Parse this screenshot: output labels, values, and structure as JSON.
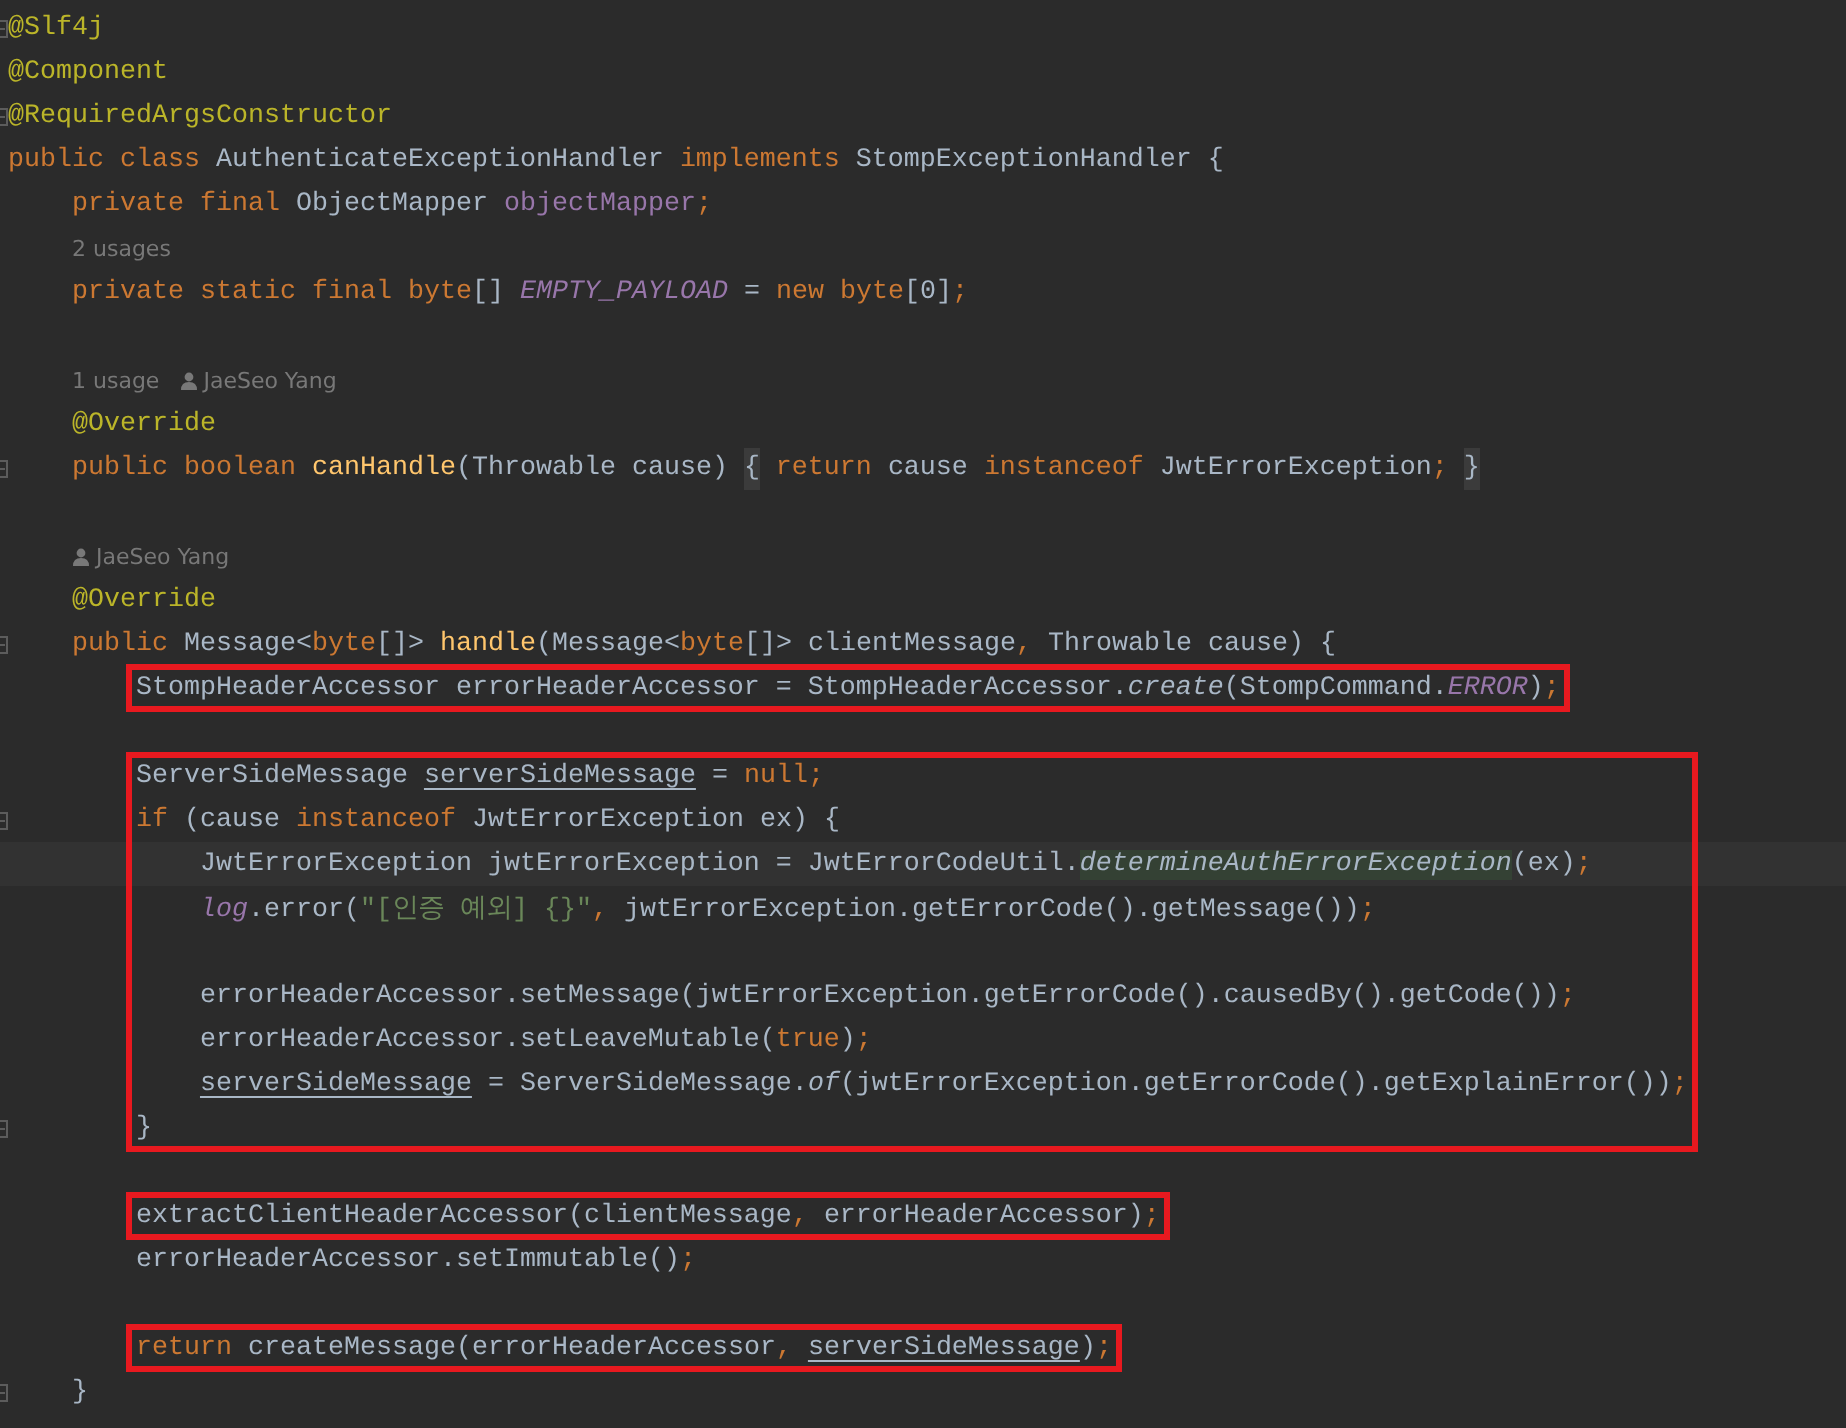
{
  "editor": {
    "blocks": [
      {
        "lines": [
          {
            "kind": "code",
            "fold": true,
            "tokens": [
              {
                "kind": "ann",
                "text": "@Slf4j"
              }
            ]
          },
          {
            "kind": "code",
            "tokens": [
              {
                "kind": "ann",
                "text": "@Component"
              }
            ]
          },
          {
            "kind": "code",
            "fold": true,
            "tokens": [
              {
                "kind": "ann",
                "text": "@RequiredArgsConstructor"
              }
            ]
          },
          {
            "kind": "code",
            "tokens": [
              {
                "kind": "kw",
                "text": "public class "
              },
              {
                "kind": "plain",
                "text": "AuthenticateExceptionHandler "
              },
              {
                "kind": "kw",
                "text": "implements "
              },
              {
                "kind": "plain",
                "text": "StompExceptionHandler {"
              }
            ]
          },
          {
            "kind": "code",
            "tokens": [
              {
                "kind": "kw",
                "text": "    private final "
              },
              {
                "kind": "plain",
                "text": "ObjectMapper "
              },
              {
                "kind": "field",
                "text": "objectMapper"
              },
              {
                "kind": "kw",
                "text": ";"
              }
            ]
          },
          {
            "kind": "hint",
            "tokens": [
              {
                "kind": "hint",
                "text": "    2 usages"
              }
            ]
          },
          {
            "kind": "code",
            "tokens": [
              {
                "kind": "kw",
                "text": "    private static final byte"
              },
              {
                "kind": "plain",
                "text": "[] "
              },
              {
                "kind": "sfield",
                "text": "EMPTY_PAYLOAD"
              },
              {
                "kind": "plain",
                "text": " = "
              },
              {
                "kind": "kw",
                "text": "new byte"
              },
              {
                "kind": "plain",
                "text": "[0]"
              },
              {
                "kind": "kw",
                "text": ";"
              }
            ]
          },
          {
            "kind": "blank"
          },
          {
            "kind": "hint",
            "tokens": [
              {
                "kind": "hint",
                "text": "    1 usage"
              },
              {
                "kind": "author",
                "text": "JaeSeo Yang"
              }
            ]
          },
          {
            "kind": "code",
            "tokens": [
              {
                "kind": "ann",
                "text": "    @Override"
              }
            ]
          },
          {
            "kind": "code",
            "fold": true,
            "tokens": [
              {
                "kind": "kw",
                "text": "    public boolean "
              },
              {
                "kind": "method",
                "text": "canHandle"
              },
              {
                "kind": "plain",
                "text": "(Throwable cause) "
              },
              {
                "kind": "foldbrace",
                "text": "{"
              },
              {
                "kind": "kw",
                "text": " return "
              },
              {
                "kind": "plain",
                "text": "cause "
              },
              {
                "kind": "kw",
                "text": "instanceof "
              },
              {
                "kind": "plain",
                "text": "JwtErrorException"
              },
              {
                "kind": "kw",
                "text": "; "
              },
              {
                "kind": "foldbrace",
                "text": "}"
              }
            ]
          },
          {
            "kind": "blank"
          },
          {
            "kind": "hint",
            "tokens": [
              {
                "kind": "author",
                "text": "    JaeSeo Yang"
              }
            ]
          },
          {
            "kind": "code",
            "tokens": [
              {
                "kind": "ann",
                "text": "    @Override"
              }
            ]
          },
          {
            "kind": "code",
            "fold": true,
            "tokens": [
              {
                "kind": "kw",
                "text": "    public "
              },
              {
                "kind": "plain",
                "text": "Message<"
              },
              {
                "kind": "kw",
                "text": "byte"
              },
              {
                "kind": "plain",
                "text": "[]> "
              },
              {
                "kind": "method",
                "text": "handle"
              },
              {
                "kind": "plain",
                "text": "(Message<"
              },
              {
                "kind": "kw",
                "text": "byte"
              },
              {
                "kind": "plain",
                "text": "[]> clientMessage"
              },
              {
                "kind": "kw",
                "text": ", "
              },
              {
                "kind": "plain",
                "text": "Throwable cause) {"
              }
            ]
          }
        ]
      },
      {
        "boxed": true,
        "lines": [
          {
            "kind": "code",
            "tokens": [
              {
                "kind": "plain",
                "text": "        StompHeaderAccessor errorHeaderAccessor = StompHeaderAccessor."
              },
              {
                "kind": "italic",
                "text": "create"
              },
              {
                "kind": "plain",
                "text": "(StompCommand."
              },
              {
                "kind": "sfield",
                "text": "ERROR"
              },
              {
                "kind": "plain",
                "text": ")"
              },
              {
                "kind": "kw",
                "text": ";"
              }
            ]
          }
        ]
      },
      {
        "lines": [
          {
            "kind": "blank"
          }
        ]
      },
      {
        "boxed": true,
        "lines": [
          {
            "kind": "code",
            "tokens": [
              {
                "kind": "plain",
                "text": "        ServerSideMessage "
              },
              {
                "kind": "reassigned",
                "text": "serverSideMessage"
              },
              {
                "kind": "plain",
                "text": " = "
              },
              {
                "kind": "kw",
                "text": "null;"
              }
            ]
          },
          {
            "kind": "code",
            "fold": true,
            "tokens": [
              {
                "kind": "kw",
                "text": "        if "
              },
              {
                "kind": "plain",
                "text": "(cause "
              },
              {
                "kind": "kw",
                "text": "instanceof "
              },
              {
                "kind": "plain",
                "text": "JwtErrorException ex) {"
              }
            ]
          },
          {
            "kind": "code",
            "current": true,
            "tokens": [
              {
                "kind": "plain",
                "text": "            JwtErrorException jwtErrorException = JwtErrorCodeUtil."
              },
              {
                "kind": "match",
                "text": "determineAuthErrorException"
              },
              {
                "kind": "plain",
                "text": "(ex)"
              },
              {
                "kind": "kw",
                "text": ";"
              }
            ]
          },
          {
            "kind": "code",
            "tokens": [
              {
                "kind": "sfield",
                "text": "            log"
              },
              {
                "kind": "plain",
                "text": ".error("
              },
              {
                "kind": "string",
                "text": "\"[인증 예외] {}\""
              },
              {
                "kind": "kw",
                "text": ", "
              },
              {
                "kind": "plain",
                "text": "jwtErrorException.getErrorCode().getMessage())"
              },
              {
                "kind": "kw",
                "text": ";"
              }
            ]
          },
          {
            "kind": "blank"
          },
          {
            "kind": "code",
            "tokens": [
              {
                "kind": "plain",
                "text": "            errorHeaderAccessor.setMessage(jwtErrorException.getErrorCode().causedBy().getCode())"
              },
              {
                "kind": "kw",
                "text": ";"
              }
            ]
          },
          {
            "kind": "code",
            "tokens": [
              {
                "kind": "plain",
                "text": "            errorHeaderAccessor.setLeaveMutable("
              },
              {
                "kind": "kw",
                "text": "true"
              },
              {
                "kind": "plain",
                "text": ")"
              },
              {
                "kind": "kw",
                "text": ";"
              }
            ]
          },
          {
            "kind": "code",
            "tokens": [
              {
                "kind": "reassigned",
                "text": "            serverSideMessage"
              },
              {
                "kind": "plain",
                "text": " = ServerSideMessage."
              },
              {
                "kind": "italic",
                "text": "of"
              },
              {
                "kind": "plain",
                "text": "(jwtErrorException.getErrorCode().getExplainError())"
              },
              {
                "kind": "kw",
                "text": ";"
              }
            ]
          },
          {
            "kind": "code",
            "fold": true,
            "tokens": [
              {
                "kind": "plain",
                "text": "        }"
              }
            ]
          }
        ]
      },
      {
        "lines": [
          {
            "kind": "blank"
          }
        ]
      },
      {
        "boxed": true,
        "lines": [
          {
            "kind": "code",
            "tokens": [
              {
                "kind": "plain",
                "text": "        extractClientHeaderAccessor(clientMessage"
              },
              {
                "kind": "kw",
                "text": ", "
              },
              {
                "kind": "plain",
                "text": "errorHeaderAccessor)"
              },
              {
                "kind": "kw",
                "text": ";"
              }
            ]
          }
        ]
      },
      {
        "lines": [
          {
            "kind": "code",
            "tokens": [
              {
                "kind": "plain",
                "text": "        errorHeaderAccessor.setImmutable()"
              },
              {
                "kind": "kw",
                "text": ";"
              }
            ]
          },
          {
            "kind": "blank"
          }
        ]
      },
      {
        "boxed": true,
        "lines": [
          {
            "kind": "code",
            "tokens": [
              {
                "kind": "kw",
                "text": "        return "
              },
              {
                "kind": "plain",
                "text": "createMessage(errorHeaderAccessor"
              },
              {
                "kind": "kw",
                "text": ", "
              },
              {
                "kind": "reassigned",
                "text": "serverSideMessage"
              },
              {
                "kind": "plain",
                "text": ")"
              },
              {
                "kind": "kw",
                "text": ";"
              }
            ]
          }
        ]
      },
      {
        "lines": [
          {
            "kind": "code",
            "fold": true,
            "tokens": [
              {
                "kind": "plain",
                "text": "    }"
              }
            ]
          }
        ]
      }
    ]
  }
}
